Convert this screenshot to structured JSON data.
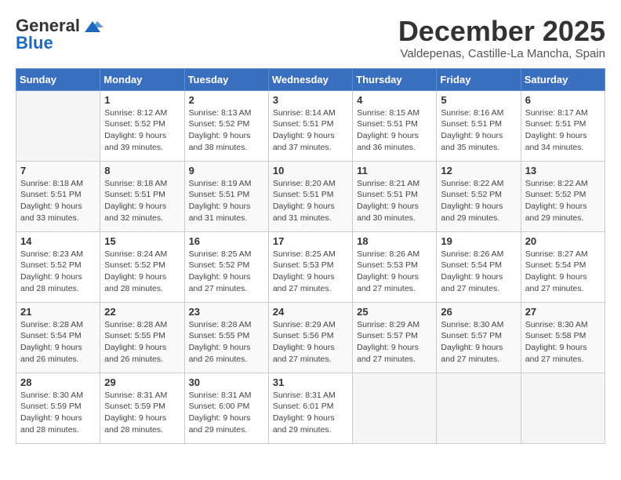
{
  "header": {
    "logo_line1": "General",
    "logo_line2": "Blue",
    "month": "December 2025",
    "location": "Valdepenas, Castille-La Mancha, Spain"
  },
  "days_of_week": [
    "Sunday",
    "Monday",
    "Tuesday",
    "Wednesday",
    "Thursday",
    "Friday",
    "Saturday"
  ],
  "weeks": [
    [
      {
        "day": "",
        "sunrise": "",
        "sunset": "",
        "daylight": ""
      },
      {
        "day": "1",
        "sunrise": "Sunrise: 8:12 AM",
        "sunset": "Sunset: 5:52 PM",
        "daylight": "Daylight: 9 hours and 39 minutes."
      },
      {
        "day": "2",
        "sunrise": "Sunrise: 8:13 AM",
        "sunset": "Sunset: 5:52 PM",
        "daylight": "Daylight: 9 hours and 38 minutes."
      },
      {
        "day": "3",
        "sunrise": "Sunrise: 8:14 AM",
        "sunset": "Sunset: 5:51 PM",
        "daylight": "Daylight: 9 hours and 37 minutes."
      },
      {
        "day": "4",
        "sunrise": "Sunrise: 8:15 AM",
        "sunset": "Sunset: 5:51 PM",
        "daylight": "Daylight: 9 hours and 36 minutes."
      },
      {
        "day": "5",
        "sunrise": "Sunrise: 8:16 AM",
        "sunset": "Sunset: 5:51 PM",
        "daylight": "Daylight: 9 hours and 35 minutes."
      },
      {
        "day": "6",
        "sunrise": "Sunrise: 8:17 AM",
        "sunset": "Sunset: 5:51 PM",
        "daylight": "Daylight: 9 hours and 34 minutes."
      }
    ],
    [
      {
        "day": "7",
        "sunrise": "Sunrise: 8:18 AM",
        "sunset": "Sunset: 5:51 PM",
        "daylight": "Daylight: 9 hours and 33 minutes."
      },
      {
        "day": "8",
        "sunrise": "Sunrise: 8:18 AM",
        "sunset": "Sunset: 5:51 PM",
        "daylight": "Daylight: 9 hours and 32 minutes."
      },
      {
        "day": "9",
        "sunrise": "Sunrise: 8:19 AM",
        "sunset": "Sunset: 5:51 PM",
        "daylight": "Daylight: 9 hours and 31 minutes."
      },
      {
        "day": "10",
        "sunrise": "Sunrise: 8:20 AM",
        "sunset": "Sunset: 5:51 PM",
        "daylight": "Daylight: 9 hours and 31 minutes."
      },
      {
        "day": "11",
        "sunrise": "Sunrise: 8:21 AM",
        "sunset": "Sunset: 5:51 PM",
        "daylight": "Daylight: 9 hours and 30 minutes."
      },
      {
        "day": "12",
        "sunrise": "Sunrise: 8:22 AM",
        "sunset": "Sunset: 5:52 PM",
        "daylight": "Daylight: 9 hours and 29 minutes."
      },
      {
        "day": "13",
        "sunrise": "Sunrise: 8:22 AM",
        "sunset": "Sunset: 5:52 PM",
        "daylight": "Daylight: 9 hours and 29 minutes."
      }
    ],
    [
      {
        "day": "14",
        "sunrise": "Sunrise: 8:23 AM",
        "sunset": "Sunset: 5:52 PM",
        "daylight": "Daylight: 9 hours and 28 minutes."
      },
      {
        "day": "15",
        "sunrise": "Sunrise: 8:24 AM",
        "sunset": "Sunset: 5:52 PM",
        "daylight": "Daylight: 9 hours and 28 minutes."
      },
      {
        "day": "16",
        "sunrise": "Sunrise: 8:25 AM",
        "sunset": "Sunset: 5:52 PM",
        "daylight": "Daylight: 9 hours and 27 minutes."
      },
      {
        "day": "17",
        "sunrise": "Sunrise: 8:25 AM",
        "sunset": "Sunset: 5:53 PM",
        "daylight": "Daylight: 9 hours and 27 minutes."
      },
      {
        "day": "18",
        "sunrise": "Sunrise: 8:26 AM",
        "sunset": "Sunset: 5:53 PM",
        "daylight": "Daylight: 9 hours and 27 minutes."
      },
      {
        "day": "19",
        "sunrise": "Sunrise: 8:26 AM",
        "sunset": "Sunset: 5:54 PM",
        "daylight": "Daylight: 9 hours and 27 minutes."
      },
      {
        "day": "20",
        "sunrise": "Sunrise: 8:27 AM",
        "sunset": "Sunset: 5:54 PM",
        "daylight": "Daylight: 9 hours and 27 minutes."
      }
    ],
    [
      {
        "day": "21",
        "sunrise": "Sunrise: 8:28 AM",
        "sunset": "Sunset: 5:54 PM",
        "daylight": "Daylight: 9 hours and 26 minutes."
      },
      {
        "day": "22",
        "sunrise": "Sunrise: 8:28 AM",
        "sunset": "Sunset: 5:55 PM",
        "daylight": "Daylight: 9 hours and 26 minutes."
      },
      {
        "day": "23",
        "sunrise": "Sunrise: 8:28 AM",
        "sunset": "Sunset: 5:55 PM",
        "daylight": "Daylight: 9 hours and 26 minutes."
      },
      {
        "day": "24",
        "sunrise": "Sunrise: 8:29 AM",
        "sunset": "Sunset: 5:56 PM",
        "daylight": "Daylight: 9 hours and 27 minutes."
      },
      {
        "day": "25",
        "sunrise": "Sunrise: 8:29 AM",
        "sunset": "Sunset: 5:57 PM",
        "daylight": "Daylight: 9 hours and 27 minutes."
      },
      {
        "day": "26",
        "sunrise": "Sunrise: 8:30 AM",
        "sunset": "Sunset: 5:57 PM",
        "daylight": "Daylight: 9 hours and 27 minutes."
      },
      {
        "day": "27",
        "sunrise": "Sunrise: 8:30 AM",
        "sunset": "Sunset: 5:58 PM",
        "daylight": "Daylight: 9 hours and 27 minutes."
      }
    ],
    [
      {
        "day": "28",
        "sunrise": "Sunrise: 8:30 AM",
        "sunset": "Sunset: 5:59 PM",
        "daylight": "Daylight: 9 hours and 28 minutes."
      },
      {
        "day": "29",
        "sunrise": "Sunrise: 8:31 AM",
        "sunset": "Sunset: 5:59 PM",
        "daylight": "Daylight: 9 hours and 28 minutes."
      },
      {
        "day": "30",
        "sunrise": "Sunrise: 8:31 AM",
        "sunset": "Sunset: 6:00 PM",
        "daylight": "Daylight: 9 hours and 29 minutes."
      },
      {
        "day": "31",
        "sunrise": "Sunrise: 8:31 AM",
        "sunset": "Sunset: 6:01 PM",
        "daylight": "Daylight: 9 hours and 29 minutes."
      },
      {
        "day": "",
        "sunrise": "",
        "sunset": "",
        "daylight": ""
      },
      {
        "day": "",
        "sunrise": "",
        "sunset": "",
        "daylight": ""
      },
      {
        "day": "",
        "sunrise": "",
        "sunset": "",
        "daylight": ""
      }
    ]
  ]
}
